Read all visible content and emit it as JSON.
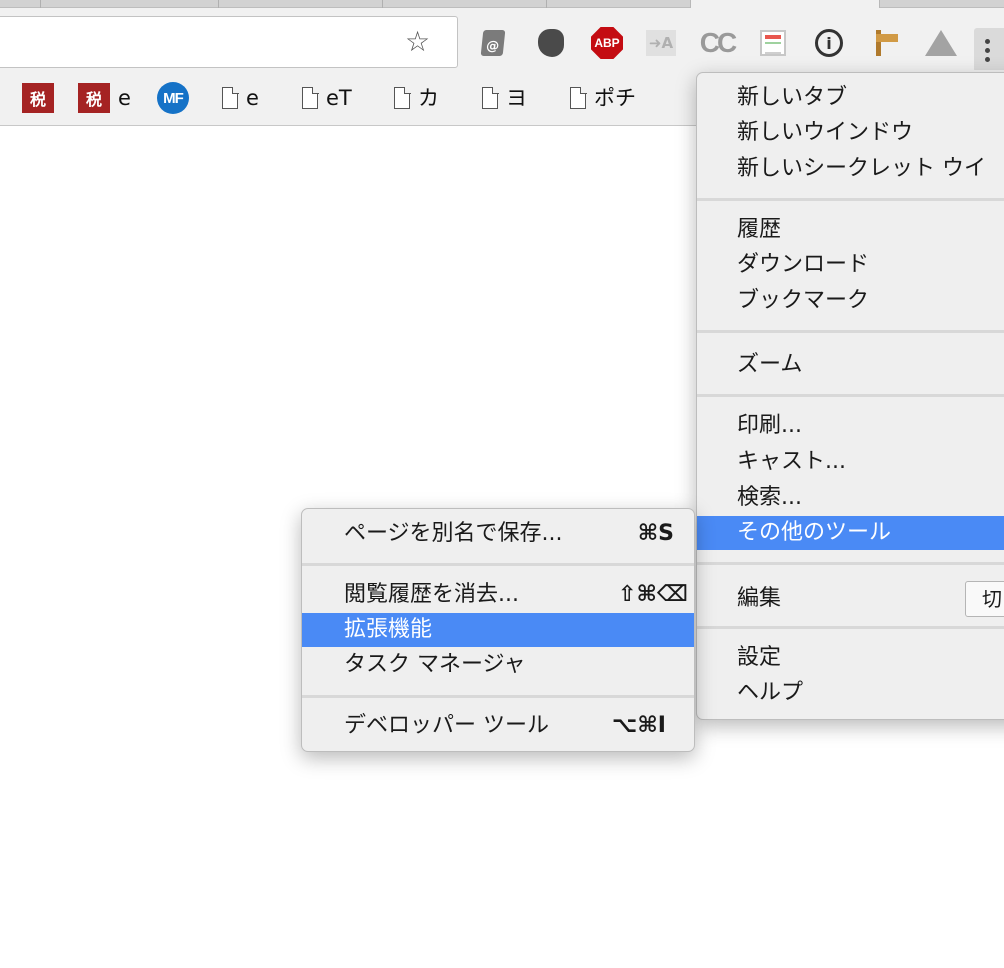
{
  "toolbar": {
    "extensions": [
      {
        "name": "mail-extension",
        "icon": "mail-at-icon",
        "glyph": "@"
      },
      {
        "name": "evernote-extension",
        "icon": "evernote-elephant-icon",
        "glyph": ""
      },
      {
        "name": "adblock-plus-extension",
        "icon": "abp-stop-sign-icon",
        "glyph": "ABP"
      },
      {
        "name": "translate-extension",
        "icon": "translate-arrow-icon",
        "glyph": "➜A"
      },
      {
        "name": "cc-extension",
        "icon": "cc-icon",
        "glyph": "CC"
      },
      {
        "name": "reader-extension",
        "icon": "reader-page-icon",
        "glyph": ""
      },
      {
        "name": "onepassword-extension",
        "icon": "onepassword-keyhole-icon",
        "glyph": "i"
      },
      {
        "name": "signpost-extension",
        "icon": "signpost-icon",
        "glyph": ""
      },
      {
        "name": "drive-extension",
        "icon": "drive-triangle-icon",
        "glyph": ""
      }
    ],
    "star_glyph": "☆"
  },
  "bookmarks": [
    {
      "icon": "tax-icon",
      "icon_text": "税",
      "label": ""
    },
    {
      "icon": "tax-icon",
      "icon_text": "税",
      "label": "e"
    },
    {
      "icon": "mf-icon",
      "icon_text": "MF",
      "label": ""
    },
    {
      "icon": "document-icon",
      "icon_text": "",
      "label": "e"
    },
    {
      "icon": "document-icon",
      "icon_text": "",
      "label": "eT"
    },
    {
      "icon": "document-icon",
      "icon_text": "",
      "label": "カ"
    },
    {
      "icon": "document-icon",
      "icon_text": "",
      "label": "ヨ"
    },
    {
      "icon": "document-icon",
      "icon_text": "",
      "label": "ポチ"
    }
  ],
  "main_menu": {
    "new_tab": "新しいタブ",
    "new_window": "新しいウインドウ",
    "new_incognito": "新しいシークレット ウイ",
    "history": "履歴",
    "downloads": "ダウンロード",
    "bookmarks": "ブックマーク",
    "zoom": "ズーム",
    "print": "印刷...",
    "cast": "キャスト...",
    "find": "検索...",
    "more_tools": "その他のツール",
    "edit": "編集",
    "edit_cut": "切",
    "settings": "設定",
    "help": "ヘルプ"
  },
  "sub_menu": {
    "save_page": {
      "label": "ページを別名で保存...",
      "shortcut": "⌘S"
    },
    "clear_history": {
      "label": "閲覧履歴を消去...",
      "shortcut": "⇧⌘⌫"
    },
    "extensions": {
      "label": "拡張機能",
      "shortcut": ""
    },
    "task_manager": {
      "label": "タスク マネージャ",
      "shortcut": ""
    },
    "dev_tools": {
      "label": "デベロッパー ツール",
      "shortcut": "⌥⌘I"
    }
  },
  "colors": {
    "highlight": "#4a8af5",
    "menu_bg": "#efefef",
    "toolbar_bg": "#f1f1f1"
  }
}
